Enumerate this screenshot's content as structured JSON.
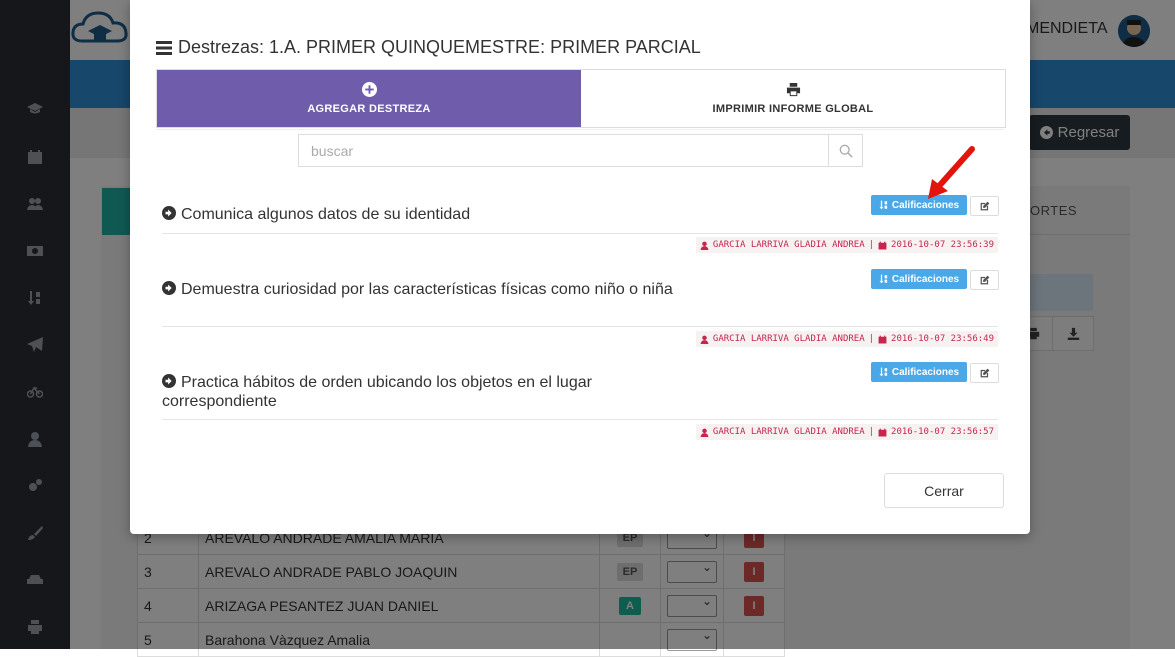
{
  "background": {
    "user_name": "MENDIETA",
    "regresar_label": "Regresar",
    "reportes_label": "ORTES",
    "students": [
      {
        "num": "2",
        "name": "AREVALO ANDRADE AMALIA MARIA",
        "badge": "EP",
        "red": "I"
      },
      {
        "num": "3",
        "name": "AREVALO ANDRADE PABLO JOAQUIN",
        "badge": "EP",
        "red": "I"
      },
      {
        "num": "4",
        "name": "ARIZAGA PESANTEZ JUAN DANIEL",
        "badge": "A",
        "red": "I"
      },
      {
        "num": "5",
        "name": "Barahona Vàzquez Amalia",
        "badge": "",
        "red": ""
      }
    ]
  },
  "modal": {
    "title": "Destrezas: 1.A. PRIMER QUINQUEMESTRE: PRIMER PARCIAL",
    "add_label": "AGREGAR DESTREZA",
    "print_label": "IMPRIMIR INFORME GLOBAL",
    "search_placeholder": "buscar",
    "calif_label": "Calificaciones",
    "close_label": "Cerrar",
    "items": [
      {
        "title": "Comunica algunos datos de su identidad",
        "author": "GARCIA LARRIVA GLADIA ANDREA",
        "date": "2016-10-07 23:56:39"
      },
      {
        "title": "Demuestra curiosidad por las características físicas como niño o niña",
        "author": "GARCIA LARRIVA GLADIA ANDREA",
        "date": "2016-10-07 23:56:49"
      },
      {
        "title": "Practica hábitos de orden ubicando los objetos en el lugar correspondiente",
        "author": "GARCIA LARRIVA GLADIA ANDREA",
        "date": "2016-10-07 23:56:57"
      }
    ],
    "meta_separator": "|"
  },
  "colors": {
    "add_tab": "#6f5dab",
    "calif_button": "#4aa8e8",
    "meta_text": "#c7254e",
    "overlay": "rgba(0,0,0,0.5)"
  }
}
